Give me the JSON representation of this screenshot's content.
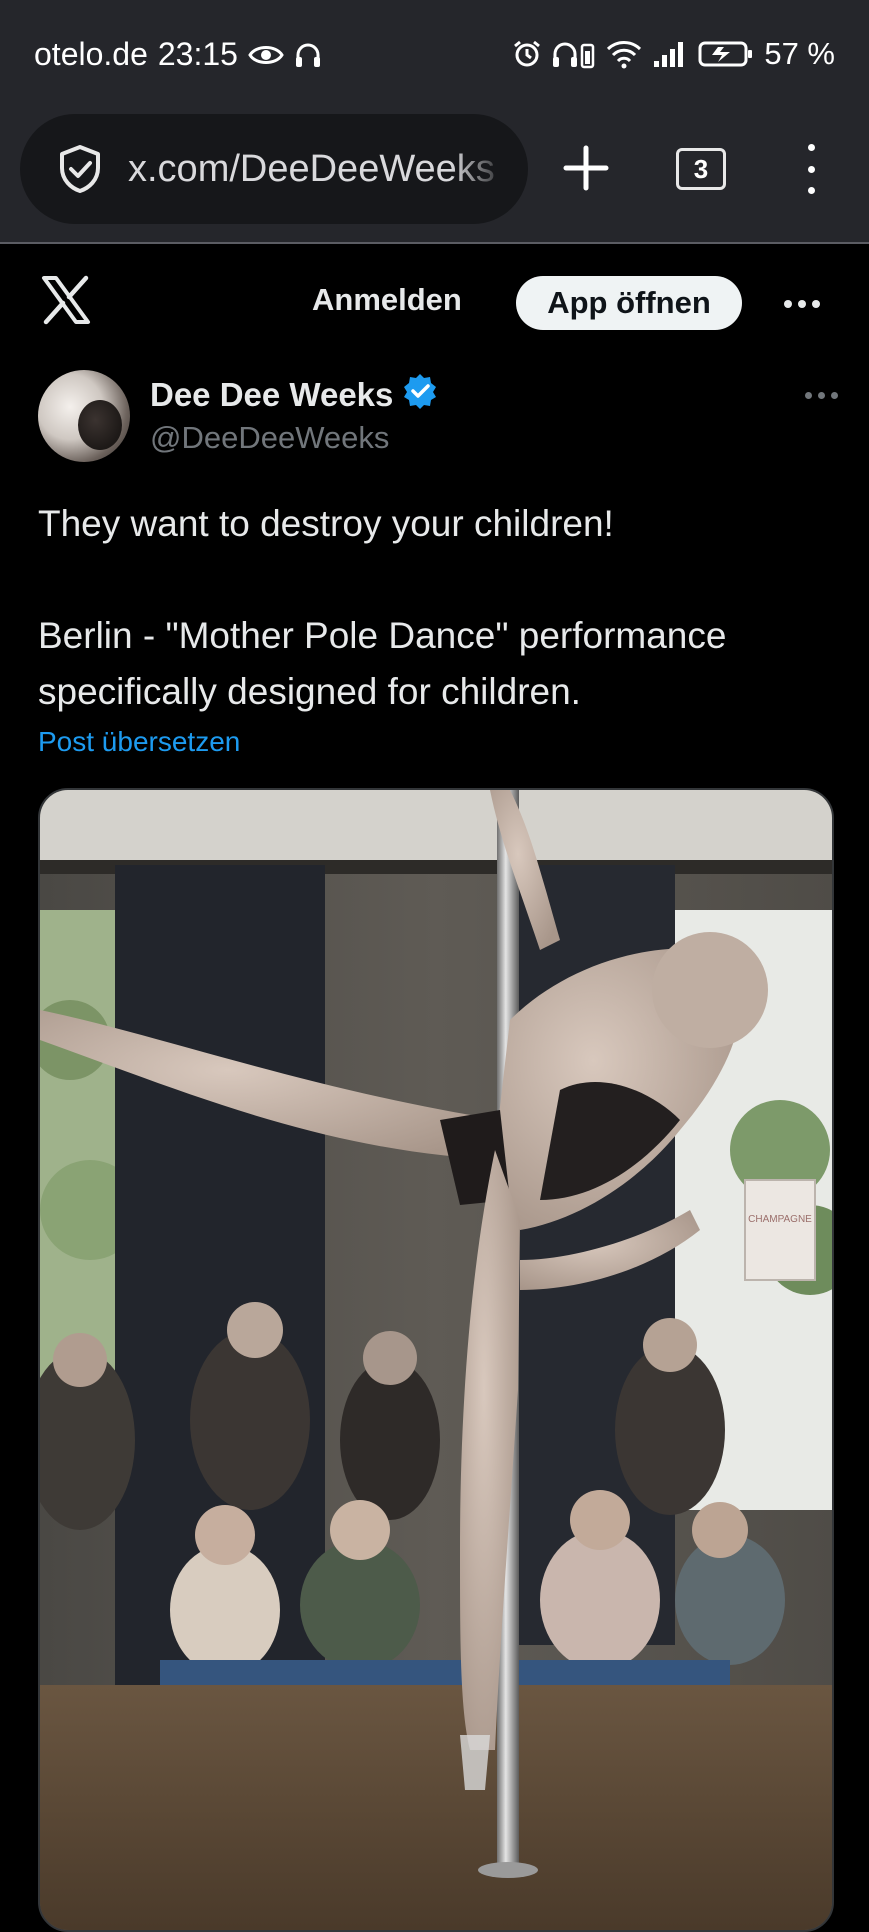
{
  "status_bar": {
    "carrier": "otelo.de",
    "time": "23:15",
    "battery": "57 %",
    "left_icons": [
      "eye-icon",
      "headphones-icon"
    ],
    "right_icons": [
      "alarm-icon",
      "headphones-battery-icon",
      "wifi-icon",
      "signal-icon",
      "battery-charging-icon"
    ]
  },
  "browser": {
    "url": "x.com/DeeDeeWeeks",
    "tab_count": "3",
    "icons": [
      "shield-check-icon",
      "plus-icon",
      "tabs-icon",
      "kebab-menu-icon"
    ]
  },
  "x_header": {
    "logo": "x-logo-icon",
    "login_label": "Anmelden",
    "open_app_label": "App öffnen",
    "more_icon": "more-dots-icon"
  },
  "post": {
    "author_name": "Dee Dee Weeks",
    "verified": true,
    "handle": "@DeeDeeWeeks",
    "text_line1": "They want to destroy your children!",
    "text_line2": "Berlin - \"Mother Pole Dance\" performance specifically designed for children.",
    "translate_label": "Post übersetzen",
    "media_sign_text": "CHAMPAGNE"
  },
  "colors": {
    "accent": "#1d9bf0",
    "background": "#000000",
    "browser_chrome": "#25262b",
    "text_primary": "#e7e9ea",
    "text_secondary": "#71767b"
  }
}
